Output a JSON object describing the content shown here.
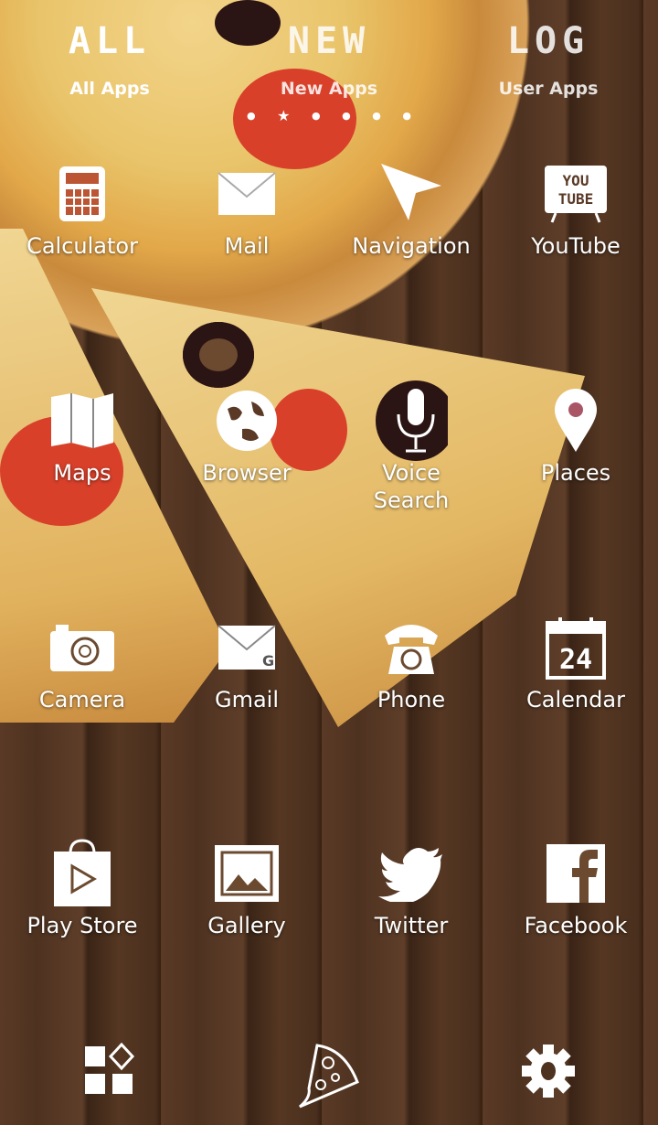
{
  "tabs": [
    {
      "big": "ALL",
      "label": "All Apps",
      "active": true
    },
    {
      "big": "NEW",
      "label": "New Apps"
    },
    {
      "big": "LOG",
      "label": "User Apps"
    }
  ],
  "page_indicator": {
    "count": 6,
    "current": 1
  },
  "apps": [
    {
      "label": "Calculator",
      "icon": "calculator-icon"
    },
    {
      "label": "Mail",
      "icon": "mail-icon"
    },
    {
      "label": "Navigation",
      "icon": "navigation-icon"
    },
    {
      "label": "YouTube",
      "icon": "youtube-icon",
      "icon_text": "YOU TUBE"
    },
    {
      "label": "Maps",
      "icon": "map-icon"
    },
    {
      "label": "Browser",
      "icon": "globe-icon"
    },
    {
      "label": "Voice\nSearch",
      "icon": "microphone-icon"
    },
    {
      "label": "Places",
      "icon": "map-pin-icon"
    },
    {
      "label": "Camera",
      "icon": "camera-icon"
    },
    {
      "label": "Gmail",
      "icon": "gmail-icon"
    },
    {
      "label": "Phone",
      "icon": "phone-icon"
    },
    {
      "label": "Calendar",
      "icon": "calendar-icon",
      "icon_text": "24"
    },
    {
      "label": "Play Store",
      "icon": "play-store-icon"
    },
    {
      "label": "Gallery",
      "icon": "gallery-icon"
    },
    {
      "label": "Twitter",
      "icon": "twitter-icon"
    },
    {
      "label": "Facebook",
      "icon": "facebook-icon"
    }
  ],
  "dock": [
    {
      "icon": "app-drawer-icon"
    },
    {
      "icon": "pizza-slice-icon"
    },
    {
      "icon": "gear-icon"
    }
  ]
}
